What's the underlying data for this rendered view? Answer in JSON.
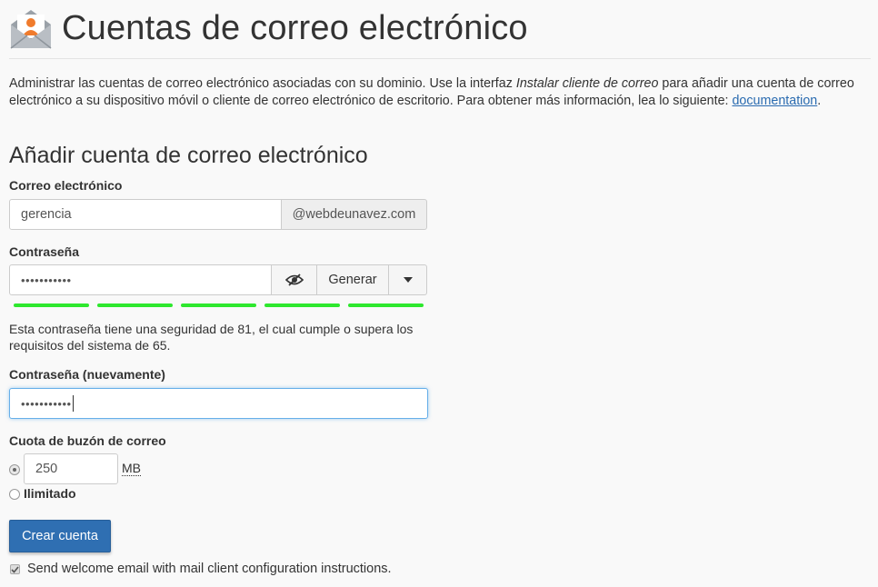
{
  "header": {
    "title": "Cuentas de correo electrónico",
    "logo_icon": "envelope-user-icon"
  },
  "intro": {
    "text_before": "Administrar las cuentas de correo electrónico asociadas con su dominio. Use la interfaz ",
    "emphasis": "Instalar cliente de correo",
    "text_after": " para añadir una cuenta de correo electrónico a su dispositivo móvil o cliente de correo electrónico de escritorio. Para obtener más información, lea lo siguiente: ",
    "link_label": "documentation",
    "trailing": "."
  },
  "form": {
    "section_title": "Añadir cuenta de correo electrónico",
    "email": {
      "label": "Correo electrónico",
      "value": "gerencia",
      "domain": "@webdeunavez.com"
    },
    "password": {
      "label": "Contraseña",
      "value": "•••••••••••",
      "toggle_icon": "eye-slash-icon",
      "generate_label": "Generar",
      "dropdown_icon": "caret-down-icon",
      "strength_color": "#2ee82e",
      "strength_segments": 5,
      "strength_text": "Esta contraseña tiene una seguridad de 81, el cual cumple o supera los requisitos del sistema de 65."
    },
    "password_again": {
      "label": "Contraseña (nuevamente)",
      "value": "•••••••••••"
    },
    "quota": {
      "label": "Cuota de buzón de correo",
      "value": "250",
      "unit": "MB",
      "unlimited_label": "Ilimitado",
      "selected": "custom"
    },
    "submit_label": "Crear cuenta",
    "welcome_email": {
      "checked": true,
      "label": "Send welcome email with mail client configuration instructions."
    }
  },
  "colors": {
    "primary": "#2f6fb2",
    "link": "#2a6bb0",
    "logo_accent": "#f07b2c",
    "focus_border": "#66afe9"
  }
}
